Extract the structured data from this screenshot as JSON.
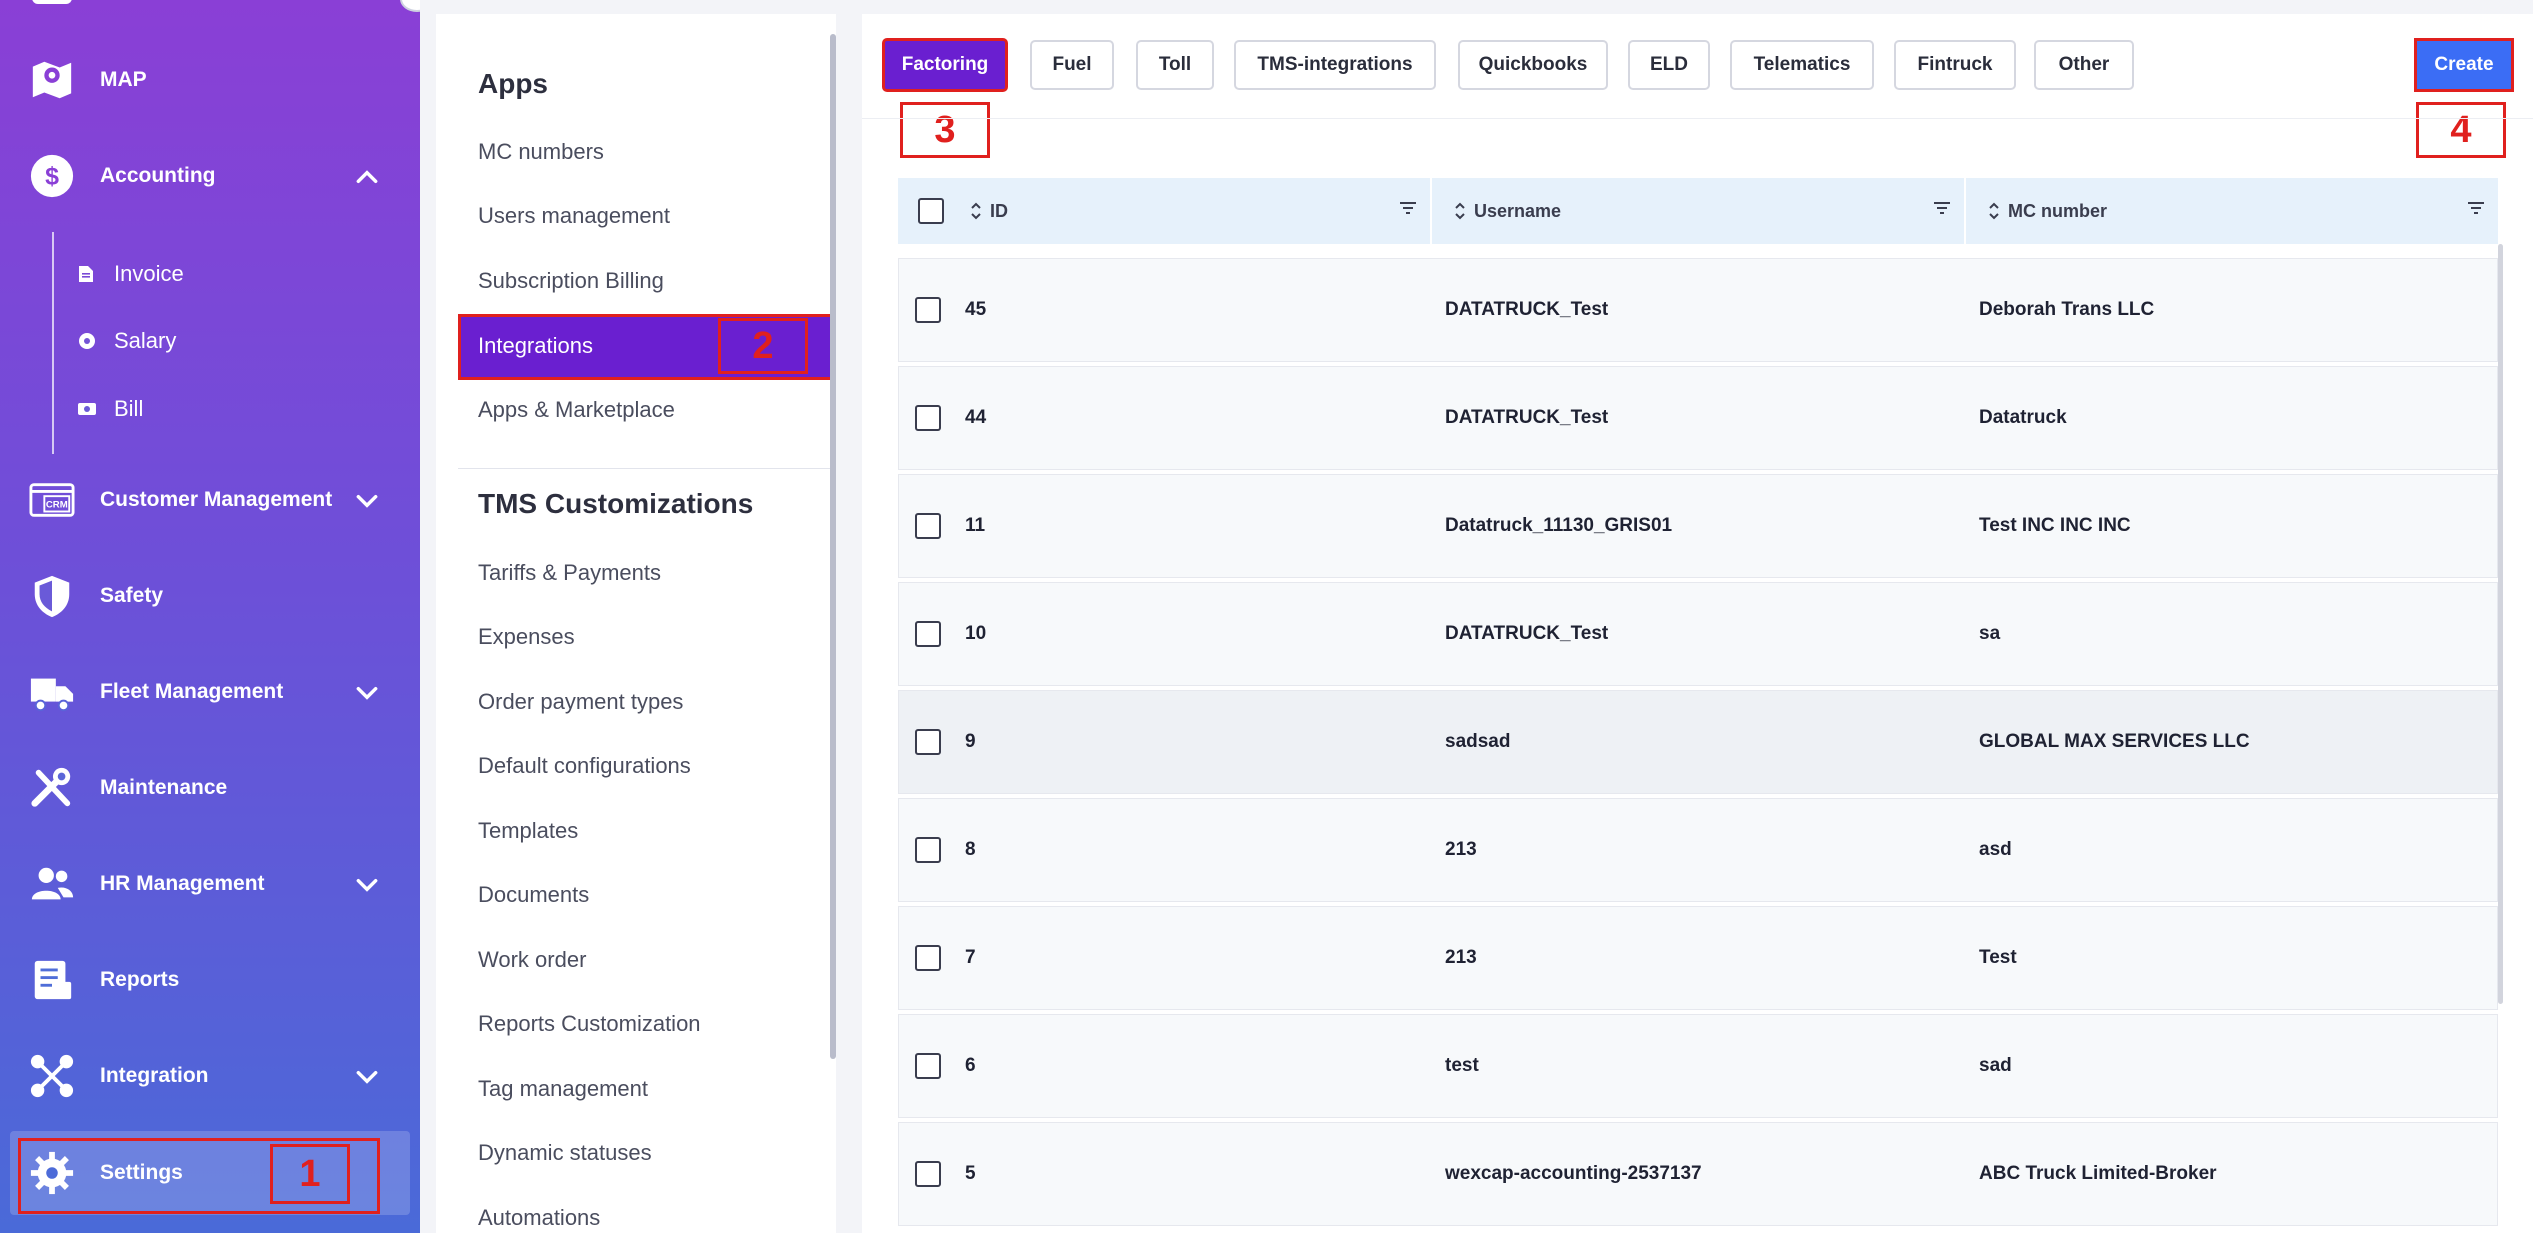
{
  "sidebar": {
    "items": [
      {
        "label": "MAP",
        "icon": "map-icon"
      },
      {
        "label": "Accounting",
        "icon": "dollar-icon"
      },
      {
        "label": "Customer Management",
        "icon": "crm-icon"
      },
      {
        "label": "Safety",
        "icon": "shield-icon"
      },
      {
        "label": "Fleet Management",
        "icon": "truck-icon"
      },
      {
        "label": "Maintenance",
        "icon": "tools-icon"
      },
      {
        "label": "HR Management",
        "icon": "people-icon"
      },
      {
        "label": "Reports",
        "icon": "report-icon"
      },
      {
        "label": "Integration",
        "icon": "integration-icon"
      },
      {
        "label": "Settings",
        "icon": "gear-icon"
      }
    ],
    "accounting_sub": [
      {
        "label": "Invoice",
        "icon": "document-icon"
      },
      {
        "label": "Salary",
        "icon": "coin-icon"
      },
      {
        "label": "Bill",
        "icon": "cash-icon"
      }
    ],
    "crm_icon_text": "CRM"
  },
  "settings_menu": {
    "apps_heading": "Apps",
    "apps_items": [
      "MC numbers",
      "Users management",
      "Subscription Billing",
      "Integrations",
      "Apps & Marketplace"
    ],
    "tms_heading": "TMS Customizations",
    "tms_items": [
      "Tariffs & Payments",
      "Expenses",
      "Order payment types",
      "Default configurations",
      "Templates",
      "Documents",
      "Work order",
      "Reports Customization",
      "Tag management",
      "Dynamic statuses",
      "Automations"
    ]
  },
  "tabs": [
    "Factoring",
    "Fuel",
    "Toll",
    "TMS-integrations",
    "Quickbooks",
    "ELD",
    "Telematics",
    "Fintruck",
    "Other"
  ],
  "create_label": "Create",
  "annotations": [
    "1",
    "2",
    "3",
    "4"
  ],
  "table": {
    "columns": [
      "ID",
      "Username",
      "MC number"
    ],
    "rows": [
      {
        "id": "45",
        "username": "DATATRUCK_Test",
        "mc": "Deborah Trans LLC"
      },
      {
        "id": "44",
        "username": "DATATRUCK_Test",
        "mc": "Datatruck"
      },
      {
        "id": "11",
        "username": "Datatruck_11130_GRIS01",
        "mc": "Test INC INC INC"
      },
      {
        "id": "10",
        "username": "DATATRUCK_Test",
        "mc": "sa"
      },
      {
        "id": "9",
        "username": "sadsad",
        "mc": "GLOBAL MAX SERVICES LLC"
      },
      {
        "id": "8",
        "username": "213",
        "mc": "asd"
      },
      {
        "id": "7",
        "username": "213",
        "mc": "Test"
      },
      {
        "id": "6",
        "username": "test",
        "mc": "sad"
      },
      {
        "id": "5",
        "username": "wexcap-accounting-2537137",
        "mc": "ABC Truck Limited-Broker"
      }
    ]
  },
  "colors": {
    "accent_purple": "#6a1fd0",
    "create_blue": "#3b6df5",
    "annotation_red": "#e0201e",
    "header_blue": "#e6f1fb"
  }
}
